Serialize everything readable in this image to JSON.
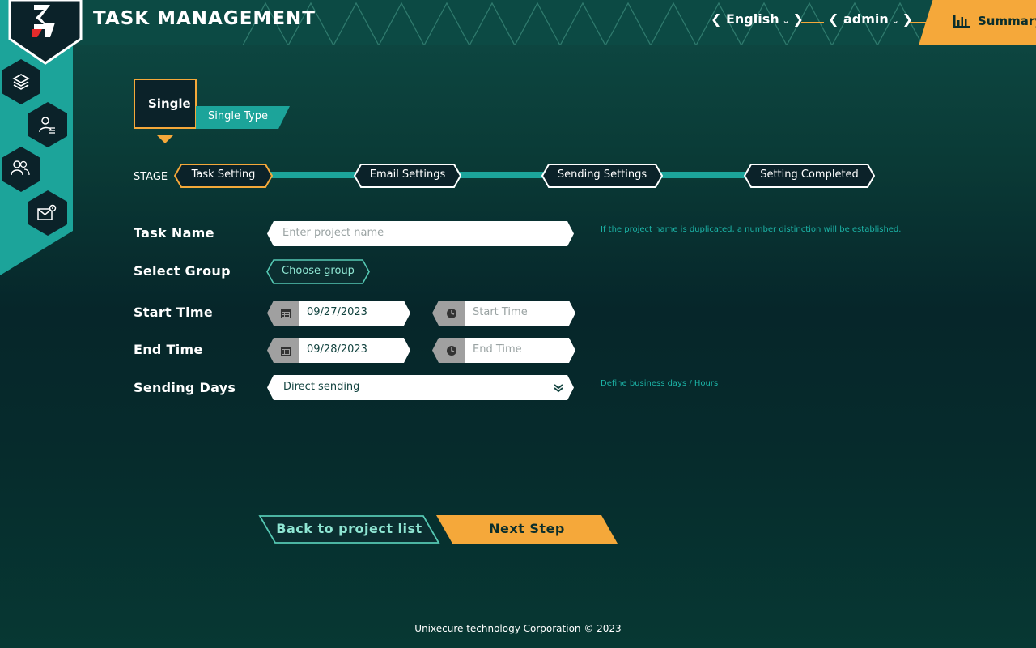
{
  "header": {
    "title": "TASK MANAGEMENT",
    "language": "English",
    "user": "admin",
    "summary_label": "Summary"
  },
  "sidebar": {
    "items": [
      {
        "icon": "layers-icon"
      },
      {
        "icon": "user-list-icon"
      },
      {
        "icon": "users-icon"
      },
      {
        "icon": "mail-settings-icon"
      }
    ]
  },
  "type": {
    "selected": "Single",
    "sub_label": "Single Type"
  },
  "stage": {
    "label": "STAGE",
    "steps": [
      "Task Setting",
      "Email Settings",
      "Sending Settings",
      "Setting Completed"
    ],
    "active_index": 0
  },
  "form": {
    "task_name": {
      "label": "Task Name",
      "placeholder": "Enter project name",
      "hint": "If the project name is duplicated, a number distinction will be established."
    },
    "select_group": {
      "label": "Select Group",
      "button": "Choose group"
    },
    "start_time": {
      "label": "Start Time",
      "date": "09/27/2023",
      "time_placeholder": "Start Time"
    },
    "end_time": {
      "label": "End Time",
      "date": "09/28/2023",
      "time_placeholder": "End Time"
    },
    "sending_days": {
      "label": "Sending Days",
      "value": "Direct sending",
      "hint": "Define business days / Hours"
    }
  },
  "actions": {
    "back": "Back to project list",
    "next": "Next Step"
  },
  "footer": {
    "text": "Unixecure technology Corporation © 2023"
  },
  "colors": {
    "accent": "#f5a83a",
    "teal": "#1ca49a",
    "dark": "#0b2229"
  }
}
